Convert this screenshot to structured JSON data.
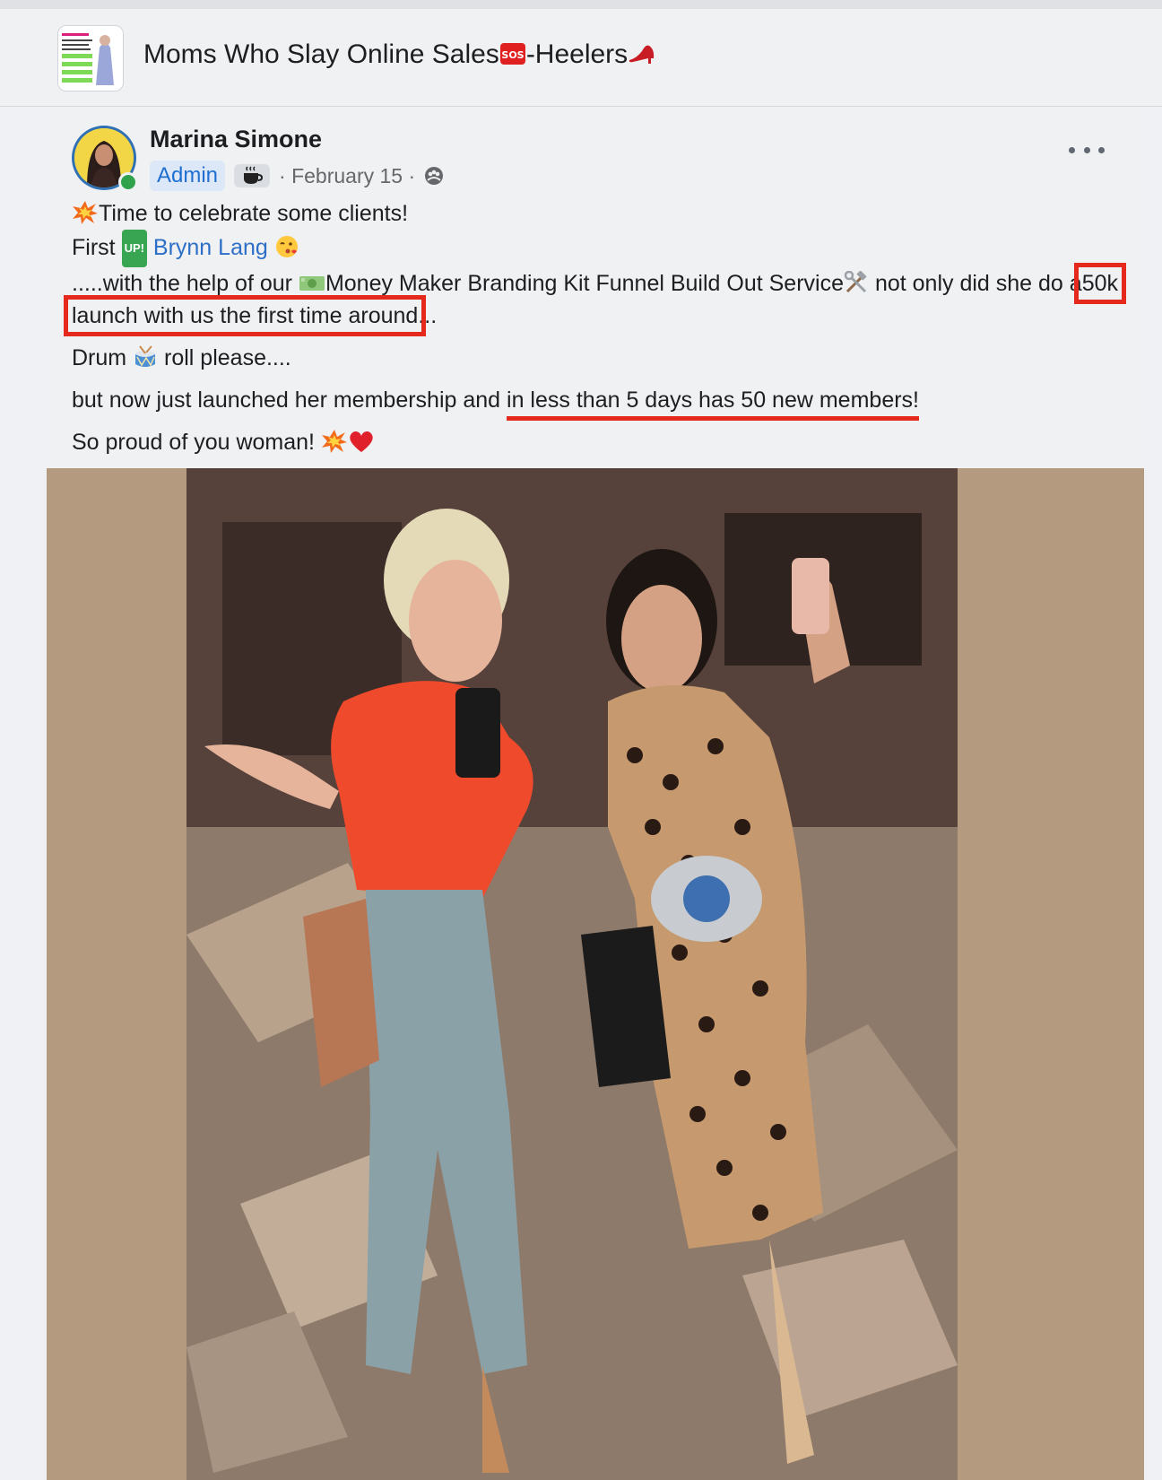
{
  "group": {
    "name": "Moms Who Slay Online Sales",
    "name_suffix": "-Heelers"
  },
  "post": {
    "author": "Marina Simone",
    "role_badge": "Admin",
    "date_text": "· February 15 ·",
    "line1": "Time to celebrate some clients!",
    "line2_prefix": "First",
    "up_badge": "UP!",
    "mention": "Brynn Lang",
    "line3_prefix": ".....with the help of our",
    "line3_service": "Money Maker Branding Kit Funnel Build Out Service",
    "line3_suffix": "not only did she do a",
    "highlight_box": "50k launch with us the first time around",
    "line3_end": "...",
    "line4_a": "Drum",
    "line4_b": "roll please....",
    "line5_prefix": "but now just launched her membership and",
    "highlight_underline": "in less than 5 days has 50 new members!",
    "line6": "So proud of you woman!"
  },
  "icons": {
    "more": "more-options-icon",
    "privacy": "group-privacy-icon",
    "coffee": "coffee-badge-icon",
    "explosion": "collision-emoji-icon",
    "heart": "heart-emoji-icon",
    "kiss": "kissing-face-emoji-icon",
    "sos": "sos-emoji-icon",
    "heel": "high-heel-emoji-icon",
    "drum": "drum-emoji-icon",
    "tools": "hammer-wrench-emoji-icon",
    "money": "money-emoji-icon"
  },
  "colors": {
    "link": "#2d6fc6",
    "highlight_red": "#e5291d",
    "online": "#31a24c",
    "photo_background": "#b49a7f"
  }
}
